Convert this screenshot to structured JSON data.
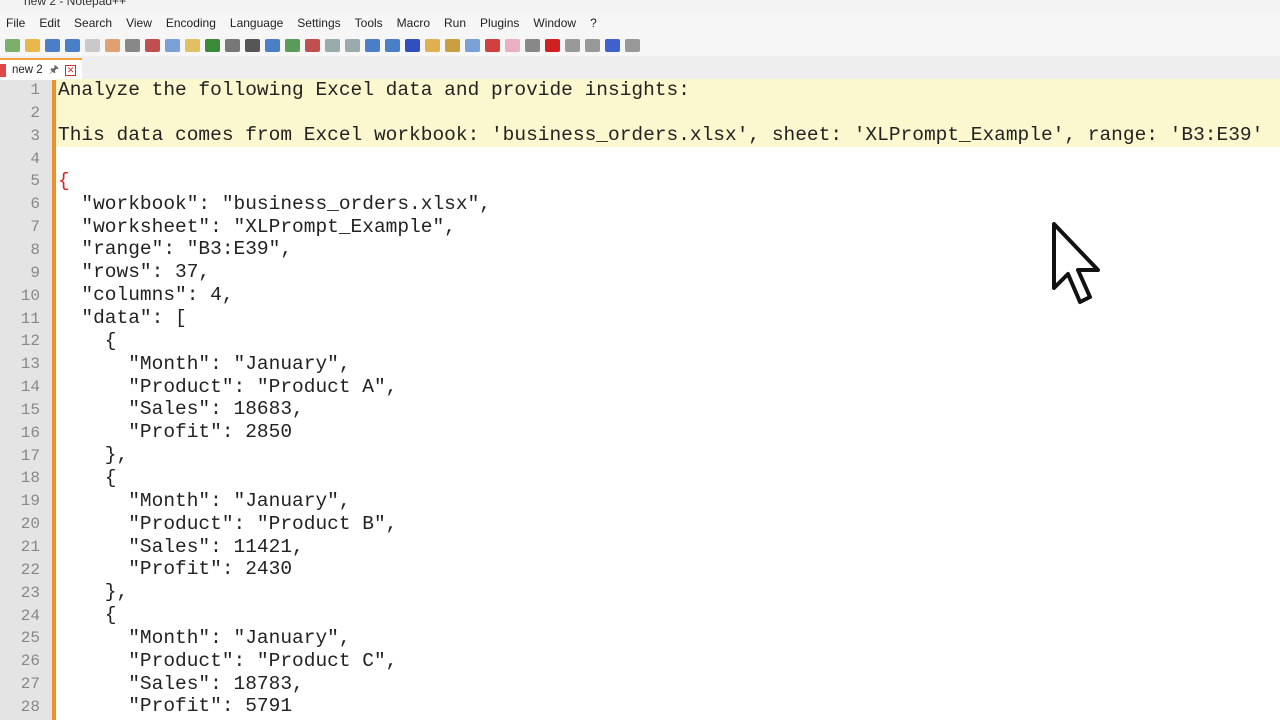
{
  "window": {
    "title": "new 2 - Notepad++"
  },
  "menu": [
    "File",
    "Edit",
    "Search",
    "View",
    "Encoding",
    "Language",
    "Settings",
    "Tools",
    "Macro",
    "Run",
    "Plugins",
    "Window",
    "?"
  ],
  "tab": {
    "label": "new 2"
  },
  "editor": {
    "lines": [
      "Analyze the following Excel data and provide insights:",
      "",
      "This data comes from Excel workbook: 'business_orders.xlsx', sheet: 'XLPrompt_Example', range: 'B3:E39'",
      "",
      "{",
      "  \"workbook\": \"business_orders.xlsx\",",
      "  \"worksheet\": \"XLPrompt_Example\",",
      "  \"range\": \"B3:E39\",",
      "  \"rows\": 37,",
      "  \"columns\": 4,",
      "  \"data\": [",
      "    {",
      "      \"Month\": \"January\",",
      "      \"Product\": \"Product A\",",
      "      \"Sales\": 18683,",
      "      \"Profit\": 2850",
      "    },",
      "    {",
      "      \"Month\": \"January\",",
      "      \"Product\": \"Product B\",",
      "      \"Sales\": 11421,",
      "      \"Profit\": 2430",
      "    },",
      "    {",
      "      \"Month\": \"January\",",
      "      \"Product\": \"Product C\",",
      "      \"Sales\": 18783,",
      "      \"Profit\": 5791"
    ]
  }
}
